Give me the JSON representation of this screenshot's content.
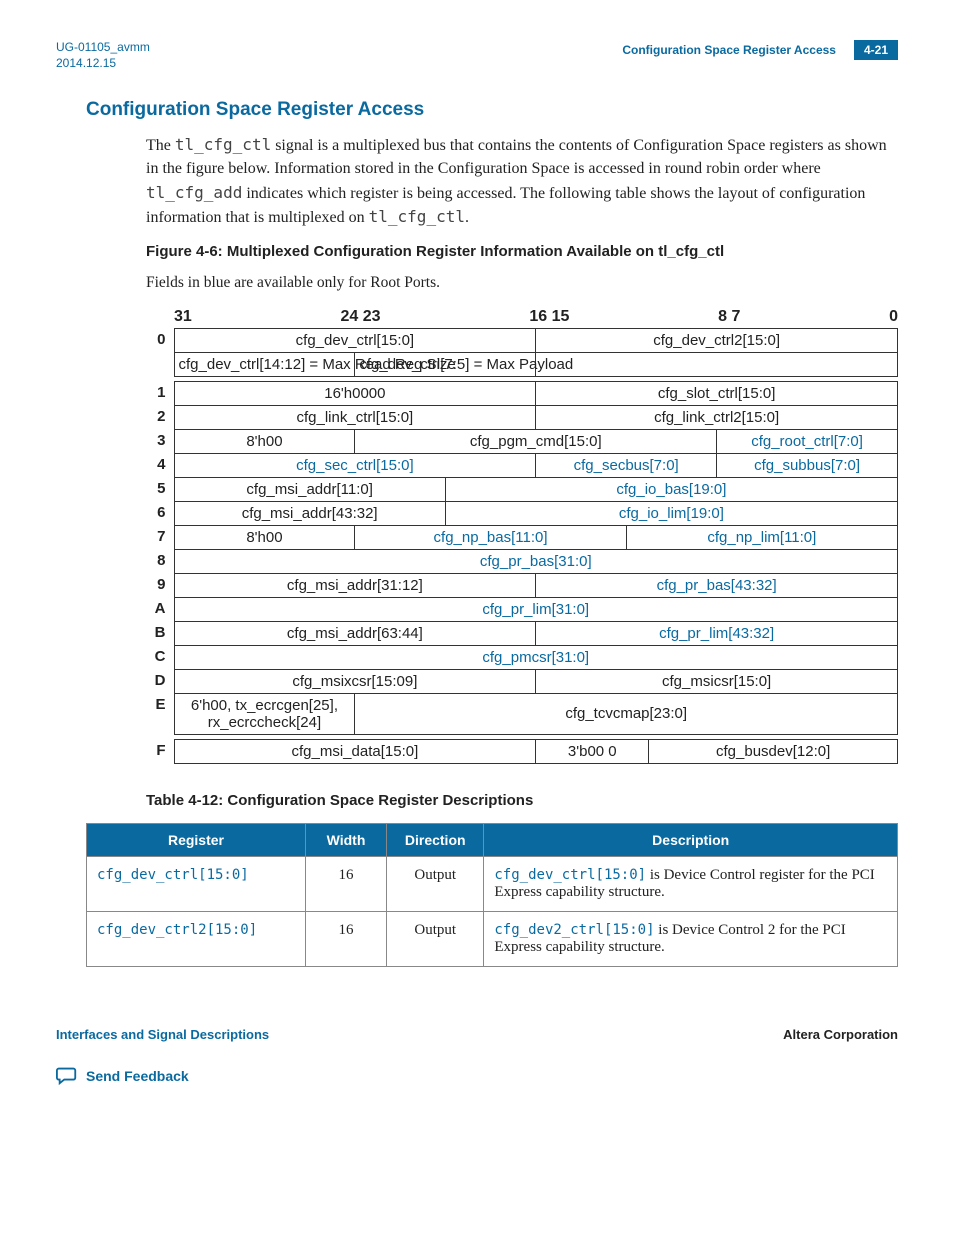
{
  "header": {
    "doc_id": "UG-01105_avmm",
    "date": "2014.12.15",
    "breadcrumb": "Configuration Space Register Access",
    "page": "4-21"
  },
  "section_title": "Configuration Space Register Access",
  "paragraph_parts": {
    "p1a": "The ",
    "sig1": "tl_cfg_ctl",
    "p1b": " signal is a multiplexed bus that contains the contents of Configuration Space registers as shown in the figure below. Information stored in the Configuration Space is accessed in round robin order where ",
    "sig2": "tl_cfg_add",
    "p1c": " indicates which register is being accessed. The following table shows the layout of configuration information that is multiplexed on ",
    "sig3": "tl_cfg_ctl",
    "p1d": "."
  },
  "figure_title": "Figure 4-6: Multiplexed Configuration Register Information Available on tl_cfg_ctl",
  "note_line": "Fields in blue are available only for Root Ports.",
  "bit_labels": {
    "b31": "31",
    "b24": "24",
    "b23": "23",
    "b16": "16",
    "b15": "15",
    "b8": "8",
    "b7": "7",
    "b0": "0"
  },
  "chart_data": {
    "type": "table",
    "title": "Multiplexed Configuration Register Information Available on tl_cfg_ctl",
    "columns_bitrange": "[31:0]",
    "note": "Fields in blue are Root Port only",
    "rows": [
      {
        "addr": "0",
        "fields": [
          {
            "span": 16,
            "text": "cfg_dev_ctrl[15:0]",
            "blue": false
          },
          {
            "span": 16,
            "text": "cfg_dev_ctrl2[15:0]",
            "blue": false
          }
        ]
      },
      {
        "addr": "",
        "fields": [
          {
            "span": 8,
            "text": "cfg_dev_ctrl[14:12] = Max Read Req Size",
            "blue": false
          },
          {
            "span": 8,
            "text": "cfg_dev_ctrl[7:5] = Max Payload",
            "blue": false
          },
          {
            "span": 16,
            "text": "",
            "blue": false
          }
        ]
      },
      {
        "addr": "1",
        "fields": [
          {
            "span": 16,
            "text": "16'h0000",
            "blue": false
          },
          {
            "span": 16,
            "text": "cfg_slot_ctrl[15:0]",
            "blue": false
          }
        ]
      },
      {
        "addr": "2",
        "fields": [
          {
            "span": 16,
            "text": "cfg_link_ctrl[15:0]",
            "blue": false
          },
          {
            "span": 16,
            "text": "cfg_link_ctrl2[15:0]",
            "blue": false
          }
        ]
      },
      {
        "addr": "3",
        "fields": [
          {
            "span": 8,
            "text": "8'h00",
            "blue": false
          },
          {
            "span": 16,
            "text": "cfg_pgm_cmd[15:0]",
            "blue": false
          },
          {
            "span": 8,
            "text": "cfg_root_ctrl[7:0]",
            "blue": true
          }
        ]
      },
      {
        "addr": "4",
        "fields": [
          {
            "span": 16,
            "text": "cfg_sec_ctrl[15:0]",
            "blue": true
          },
          {
            "span": 8,
            "text": "cfg_secbus[7:0]",
            "blue": true
          },
          {
            "span": 8,
            "text": "cfg_subbus[7:0]",
            "blue": true
          }
        ]
      },
      {
        "addr": "5",
        "fields": [
          {
            "span": 12,
            "text": "cfg_msi_addr[11:0]",
            "blue": false
          },
          {
            "span": 20,
            "text": "cfg_io_bas[19:0]",
            "blue": true
          }
        ]
      },
      {
        "addr": "6",
        "fields": [
          {
            "span": 12,
            "text": "cfg_msi_addr[43:32]",
            "blue": false
          },
          {
            "span": 20,
            "text": "cfg_io_lim[19:0]",
            "blue": true
          }
        ]
      },
      {
        "addr": "7",
        "fields": [
          {
            "span": 8,
            "text": "8'h00",
            "blue": false
          },
          {
            "span": 12,
            "text": "cfg_np_bas[11:0]",
            "blue": true
          },
          {
            "span": 12,
            "text": "cfg_np_lim[11:0]",
            "blue": true
          }
        ]
      },
      {
        "addr": "8",
        "fields": [
          {
            "span": 32,
            "text": "cfg_pr_bas[31:0]",
            "blue": true
          }
        ]
      },
      {
        "addr": "9",
        "fields": [
          {
            "span": 16,
            "text": "cfg_msi_addr[31:12]",
            "blue": false
          },
          {
            "span": 16,
            "text": "cfg_pr_bas[43:32]",
            "blue": true
          }
        ]
      },
      {
        "addr": "A",
        "fields": [
          {
            "span": 32,
            "text": "cfg_pr_lim[31:0]",
            "blue": true
          }
        ]
      },
      {
        "addr": "B",
        "fields": [
          {
            "span": 16,
            "text": "cfg_msi_addr[63:44]",
            "blue": false
          },
          {
            "span": 16,
            "text": "cfg_pr_lim[43:32]",
            "blue": true
          }
        ]
      },
      {
        "addr": "C",
        "fields": [
          {
            "span": 32,
            "text": "cfg_pmcsr[31:0]",
            "blue": true
          }
        ]
      },
      {
        "addr": "D",
        "fields": [
          {
            "span": 16,
            "text": "cfg_msixcsr[15:09]",
            "blue": false
          },
          {
            "span": 16,
            "text": "cfg_msicsr[15:0]",
            "blue": false
          }
        ]
      },
      {
        "addr": "E",
        "fields": [
          {
            "span": 8,
            "text": "6'h00, tx_ecrcgen[25], rx_ecrccheck[24]",
            "blue": false,
            "wrap": true
          },
          {
            "span": 24,
            "text": "cfg_tcvcmap[23:0]",
            "blue": false
          }
        ]
      },
      {
        "addr": "F",
        "fields": [
          {
            "span": 16,
            "text": "cfg_msi_data[15:0]",
            "blue": false
          },
          {
            "span": 5,
            "text": "3'b00 0",
            "blue": false
          },
          {
            "span": 11,
            "text": "cfg_busdev[12:0]",
            "blue": false
          }
        ]
      }
    ]
  },
  "table_title": "Table 4-12: Configuration Space Register Descriptions",
  "table_headers": {
    "c0": "Register",
    "c1": "Width",
    "c2": "Direction",
    "c3": "Description"
  },
  "desc_rows": [
    {
      "register": "cfg_dev_ctrl[15:0]",
      "width": "16",
      "direction": "Output",
      "desc_pre": "cfg_dev_ctrl[15:0]",
      "desc_post": " is Device Control register for the PCI Express capability structure."
    },
    {
      "register": "cfg_dev_ctrl2[15:0]",
      "width": "16",
      "direction": "Output",
      "desc_pre": "cfg_dev2_ctrl[15:0]",
      "desc_post": " is Device Control 2 for the PCI Express capability structure."
    }
  ],
  "footer": {
    "left": "Interfaces and Signal Descriptions",
    "right": "Altera Corporation",
    "feedback": "Send Feedback"
  }
}
